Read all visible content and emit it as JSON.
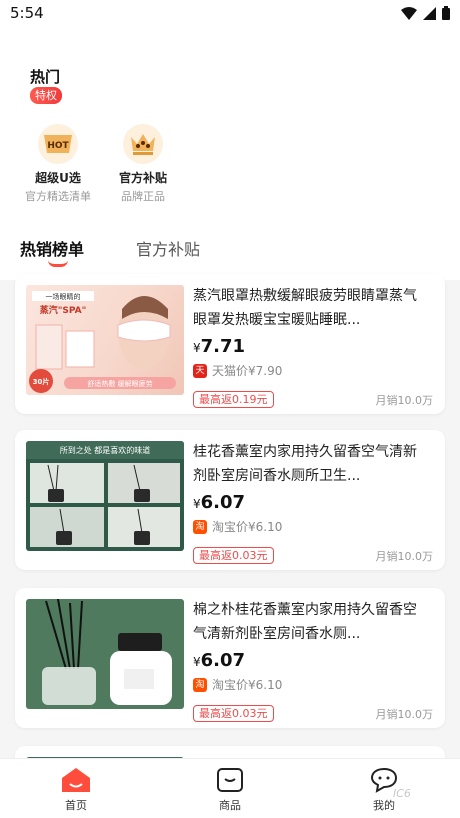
{
  "status_bar": {
    "time": "5:54"
  },
  "hot": {
    "title": "热门",
    "badge": "特权"
  },
  "features": [
    {
      "icon": "hot-icon",
      "icon_text": "HOT",
      "title": "超级U选",
      "subtitle": "官方精选清单"
    },
    {
      "icon": "crown-icon",
      "title": "官方补贴",
      "subtitle": "品牌正品"
    }
  ],
  "tabs": [
    {
      "label": "热销榜单",
      "active": true
    },
    {
      "label": "官方补贴",
      "active": false
    }
  ],
  "products": [
    {
      "title": "蒸汽眼罩热敷缓解眼疲劳眼睛罩蒸气眼罩发热暖宝宝暖贴睡眠...",
      "price_symbol": "¥",
      "price": "7.71",
      "shop_icon": "tmall-icon",
      "shop_icon_text": "天",
      "shop_color": "#e1251b",
      "origin_price": "天猫价¥7.90",
      "rebate": "最高返0.19元",
      "sales": "月销10.0万",
      "image": {
        "banner": "一场眼睛的",
        "headline": "蒸汽\"SPA\"",
        "tag": "舒适热敷 缓解眼疲劳",
        "badge": "30片"
      }
    },
    {
      "title": "桂花香薰室内家用持久留香空气清新剂卧室房间香水厕所卫生...",
      "price_symbol": "¥",
      "price": "6.07",
      "shop_icon": "taobao-icon",
      "shop_icon_text": "淘",
      "shop_color": "#ff5000",
      "origin_price": "淘宝价¥6.10",
      "rebate": "最高返0.03元",
      "sales": "月销10.0万",
      "image": {
        "banner": "所到之处 都是喜欢的味道"
      }
    },
    {
      "title": "棉之朴桂花香薰室内家用持久留香空气清新剂卧室房间香水厕...",
      "price_symbol": "¥",
      "price": "6.07",
      "shop_icon": "taobao-icon",
      "shop_icon_text": "淘",
      "shop_color": "#ff5000",
      "origin_price": "淘宝价¥6.10",
      "rebate": "最高返0.03元",
      "sales": "月销10.0万",
      "image": {}
    }
  ],
  "bottom_nav": [
    {
      "icon": "home-icon",
      "label": "首页",
      "active": true
    },
    {
      "icon": "goods-icon",
      "label": "商品",
      "active": false
    },
    {
      "icon": "chat-icon",
      "label": "我的",
      "active": false
    }
  ],
  "watermark": "IC6"
}
